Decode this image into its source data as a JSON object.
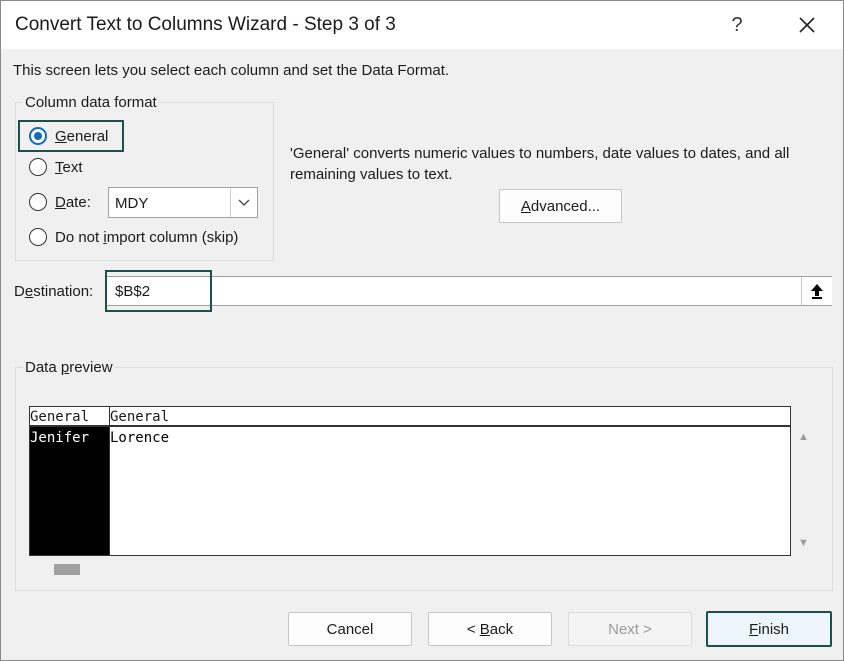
{
  "window": {
    "title": "Convert Text to Columns Wizard - Step 3 of 3",
    "help_label": "?",
    "close_label": "✕"
  },
  "intro_text": "This screen lets you select each column and set the Data Format.",
  "column_format": {
    "group_label": "Column data format",
    "options": [
      {
        "prefix": "",
        "ul": "G",
        "rest": "eneral",
        "checked": true
      },
      {
        "prefix": "",
        "ul": "T",
        "rest": "ext",
        "checked": false
      },
      {
        "prefix": "",
        "ul": "D",
        "rest": "ate:",
        "checked": false
      },
      {
        "prefix": "Do not ",
        "ul": "i",
        "rest": "mport column (skip)",
        "checked": false
      }
    ],
    "date_format_value": "MDY",
    "description": "'General' converts numeric values to numbers, date values to dates, and all remaining values to text.",
    "advanced_label": {
      "prefix": "",
      "ul": "A",
      "rest": "dvanced..."
    }
  },
  "destination": {
    "label": {
      "prefix": "D",
      "ul": "e",
      "rest": "stination:"
    },
    "value": "$B$2"
  },
  "preview": {
    "label": {
      "prefix": "Data ",
      "ul": "p",
      "rest": "review"
    },
    "headers": [
      "General",
      "General"
    ],
    "rows": [
      [
        "Jenifer",
        "Lorence"
      ]
    ]
  },
  "buttons": {
    "cancel": "Cancel",
    "back": {
      "prefix": "< ",
      "ul": "B",
      "rest": "ack"
    },
    "next": "Next >",
    "finish": {
      "prefix": "",
      "ul": "F",
      "rest": "inish"
    }
  },
  "colors": {
    "accent": "#0f6cbd",
    "focus_border": "#1e4f4f"
  },
  "icons": {
    "collapse": "arrow-up-icon",
    "dropdown": "chevron-down-icon"
  }
}
